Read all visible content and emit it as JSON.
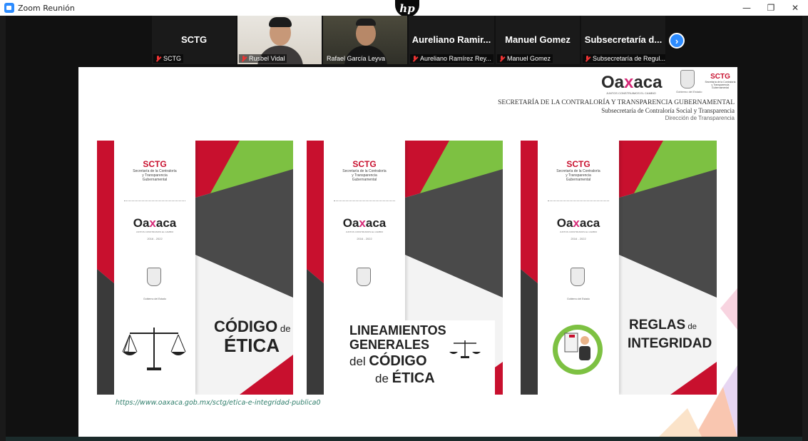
{
  "window": {
    "title": "Zoom Reunión",
    "controls": {
      "minimize": "—",
      "maximize": "❐",
      "close": "✕"
    }
  },
  "hp_logo": "hp",
  "participants": [
    {
      "display_name": "SCTG",
      "label": "SCTG",
      "video": false
    },
    {
      "display_name": "",
      "label": "Rusbel Vidal",
      "video": true
    },
    {
      "display_name": "",
      "label": "Rafael García Leyva",
      "video": true
    },
    {
      "display_name": "Aureliano Ramir...",
      "label": "Aureliano Ramírez Rey...",
      "video": false
    },
    {
      "display_name": "Manuel Gomez",
      "label": "Manuel Gomez",
      "video": false
    },
    {
      "display_name": "Subsecretaría d...",
      "label": "Subsecretaría de Regul...",
      "video": false
    }
  ],
  "next_participants_icon": "chevron-right-icon",
  "slide": {
    "brand": {
      "oax_pre": "Oa",
      "oax_x": "x",
      "oax_post": "aca",
      "tagline": "JUNTOS CONSTRUIMOS EL CAMBIO",
      "crest_caption": "Gobierno del Estado",
      "sctg": "SCTG",
      "sctg_sub": "Secretaría de la Contraloría y Transparencia Gubernamental"
    },
    "header_line1": "SECRETARÍA DE LA CONTRALORÍA Y TRANSPARENCIA GUBERNAMENTAL",
    "header_line2": "Subsecretaría de Contraloría Social y Transparencia",
    "header_line3": "Dirección de Transparencia",
    "cover_common": {
      "sctg": "SCTG",
      "sctg_sub_1": "Secretaría de la Contraloría",
      "sctg_sub_2": "y Transparencia",
      "sctg_sub_3": "Gubernamental",
      "oax_pre": "Oa",
      "oax_x": "x",
      "oax_post": "aca",
      "oax_sub": "JUNTOS CONSTRUIMOS EL CAMBIO",
      "years": "2016 - 2022",
      "crest_caption": "Gobierno del Estado"
    },
    "covers": [
      {
        "title_bold": "CÓDIGO",
        "title_light": " de",
        "title_line2": "ÉTICA"
      },
      {
        "line1": "LINEAMIENTOS",
        "line2": "GENERALES",
        "line3_light": "del ",
        "line3_bold": "CÓDIGO",
        "line4_light": "de ",
        "line4_bold": "ÉTICA"
      },
      {
        "title_bold": "REGLAS",
        "title_light": " de",
        "title_line2": "INTEGRIDAD"
      }
    ],
    "url": "https://www.oaxaca.gob.mx/sctg/etica-e-integridad-publica0"
  },
  "colors": {
    "red": "#c8102e",
    "green": "#7dc142",
    "dark": "#3a3a3a",
    "zoom_blue": "#2d8cff",
    "pink": "#d62a78"
  }
}
